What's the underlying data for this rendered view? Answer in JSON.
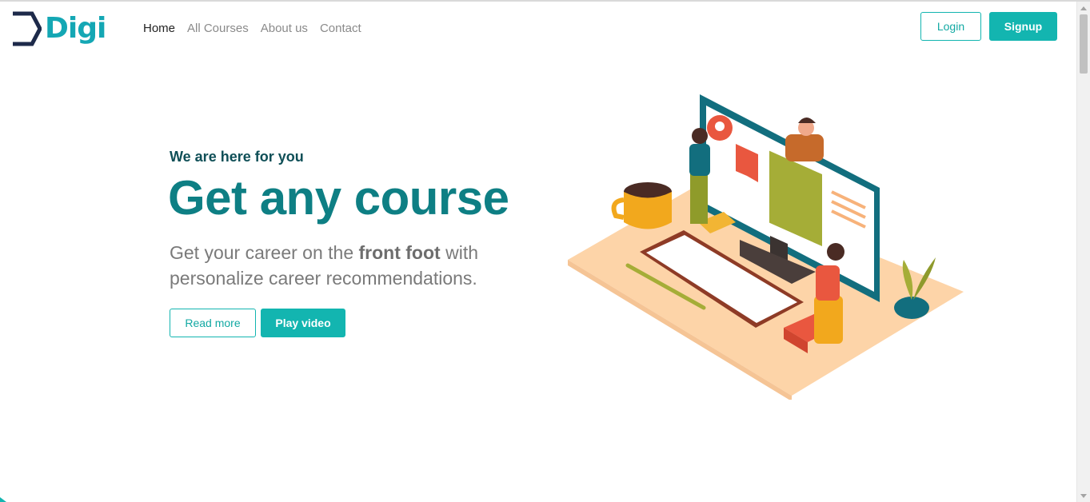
{
  "brand": {
    "name": "Digi",
    "color": "#14a7b4"
  },
  "nav": {
    "items": [
      {
        "label": "Home",
        "active": true
      },
      {
        "label": "All Courses",
        "active": false
      },
      {
        "label": "About us",
        "active": false
      },
      {
        "label": "Contact",
        "active": false
      }
    ]
  },
  "auth": {
    "login_label": "Login",
    "signup_label": "Signup"
  },
  "hero": {
    "subtitle": "We are here for you",
    "title": "Get any course",
    "desc_before": "Get your career on the ",
    "desc_bold": "front foot",
    "desc_after": " with personalize career recommendations.",
    "read_more_label": "Read more",
    "play_video_label": "Play video"
  },
  "colors": {
    "accent": "#13b5b0",
    "title": "#0e7f84",
    "subtitle": "#0f4f57"
  },
  "illustration": {
    "icon": "online-course-illustration"
  }
}
